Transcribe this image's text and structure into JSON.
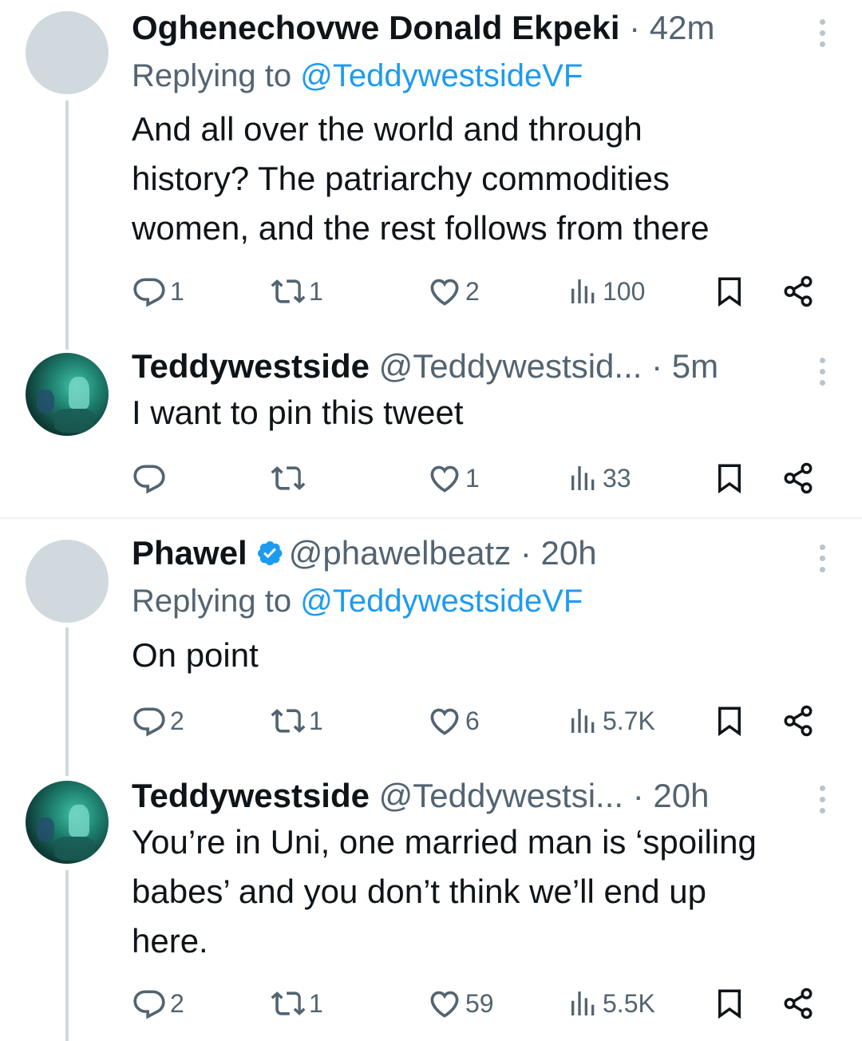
{
  "thread1": {
    "tweet": {
      "name": "Oghenechovwe Donald Ekpeki",
      "meta": "· 42m",
      "replying_label": "Replying to",
      "replying_to": "@TeddywestsideVF",
      "body_lines": [
        "And all over the world and through",
        "history? The patriarchy commodities",
        "women, and the rest follows from there"
      ],
      "replies": "1",
      "retweets": "1",
      "likes": "2",
      "views": "100"
    },
    "reply": {
      "name": "Teddywestside",
      "handle": "@Teddywestsid...",
      "meta": "· 5m",
      "body_lines": [
        "I want to pin this tweet"
      ],
      "replies": "",
      "retweets": "",
      "likes": "1",
      "views": "33"
    }
  },
  "thread2": {
    "tweet": {
      "name": "Phawel",
      "handle": "@phawelbeatz",
      "meta": "· 20h",
      "replying_label": "Replying to",
      "replying_to": "@TeddywestsideVF",
      "body_lines": [
        "On point"
      ],
      "replies": "2",
      "retweets": "1",
      "likes": "6",
      "views": "5.7K"
    },
    "reply": {
      "name": "Teddywestside",
      "handle": "@Teddywestsi...",
      "meta": "· 20h",
      "body_lines": [
        "You’re in Uni, one married man is ‘spoiling",
        "babes’ and you don’t think we’ll end up",
        "here."
      ],
      "replies": "2",
      "retweets": "1",
      "likes": "59",
      "views": "5.5K"
    }
  },
  "colors": {
    "accent": "#1d9bf0",
    "secondary_text": "#536471",
    "thread_line": "#cfd9de"
  },
  "icons": [
    "reply-icon",
    "retweet-icon",
    "like-icon",
    "views-icon",
    "bookmark-icon",
    "share-icon",
    "more-icon",
    "verified-badge-icon"
  ]
}
